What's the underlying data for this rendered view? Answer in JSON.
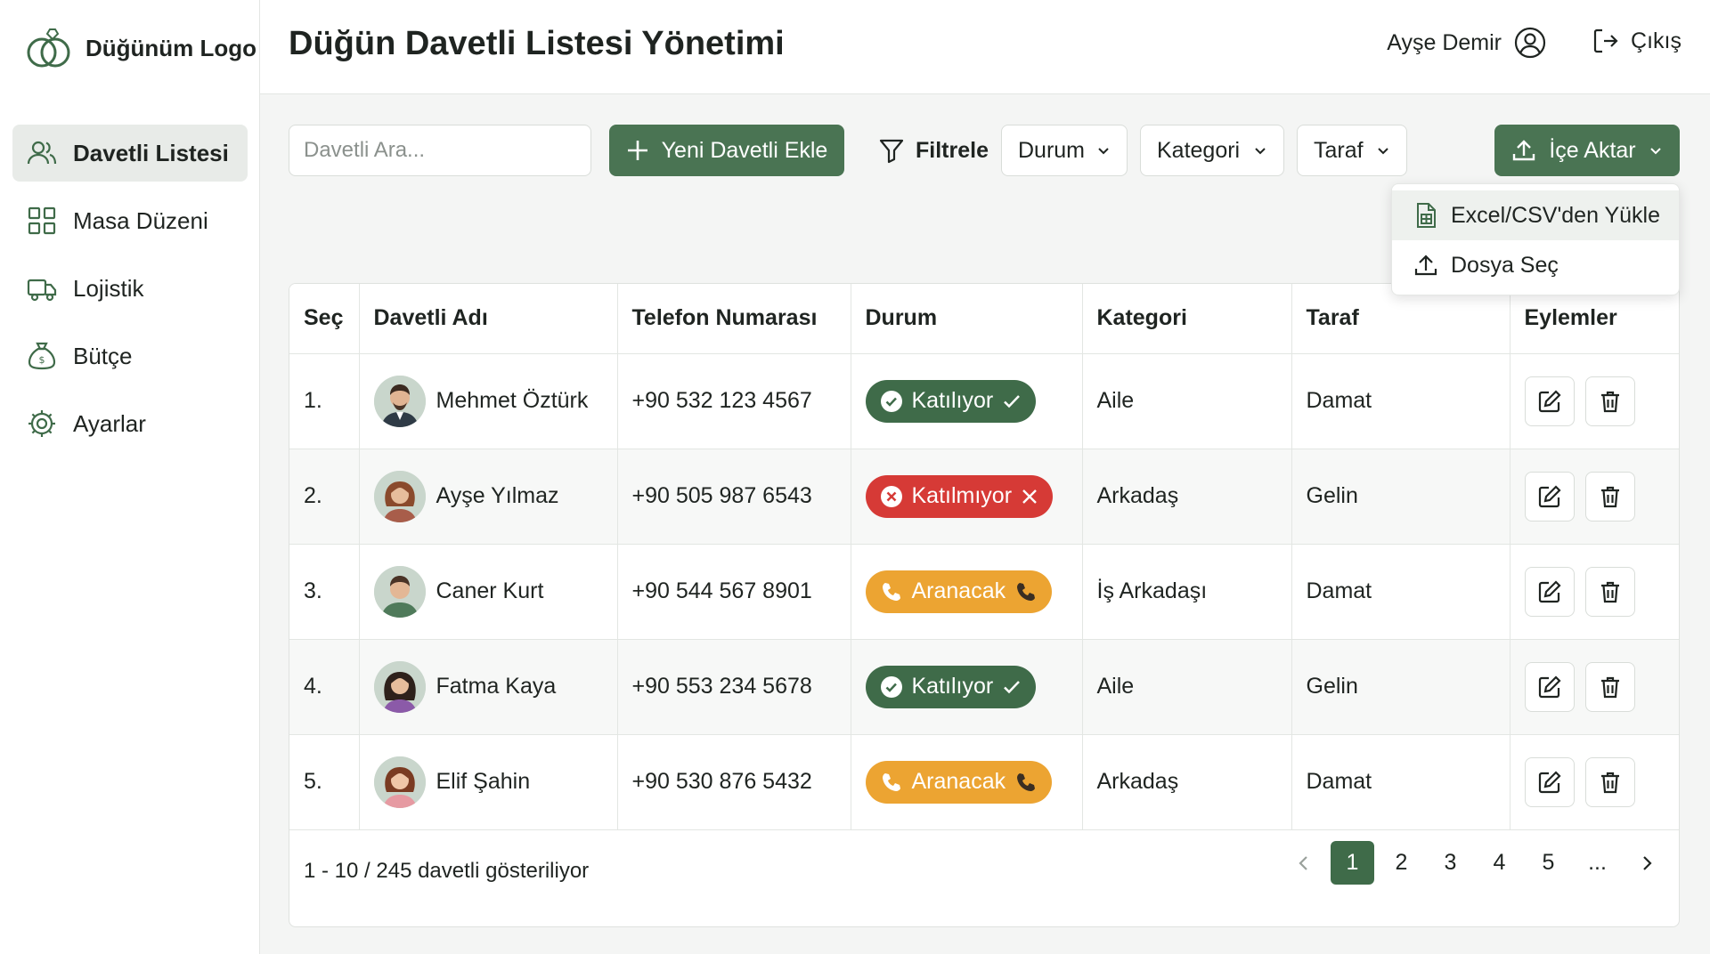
{
  "app": {
    "logo_text": "Düğünüm Logo",
    "page_title": "Düğün Davetli Listesi Yönetimi"
  },
  "sidebar": {
    "items": [
      {
        "label": "Davetli Listesi",
        "icon": "users-icon",
        "active": true
      },
      {
        "label": "Masa Düzeni",
        "icon": "grid-icon",
        "active": false
      },
      {
        "label": "Lojistik",
        "icon": "truck-icon",
        "active": false
      },
      {
        "label": "Bütçe",
        "icon": "money-bag-icon",
        "active": false
      },
      {
        "label": "Ayarlar",
        "icon": "gear-icon",
        "active": false
      }
    ]
  },
  "header": {
    "user_name": "Ayşe Demir",
    "logout_label": "Çıkış"
  },
  "toolbar": {
    "search_placeholder": "Davetli Ara...",
    "add_label": "Yeni Davetli Ekle",
    "filter_label": "Filtrele",
    "status_dd": "Durum",
    "category_dd": "Kategori",
    "side_dd": "Taraf",
    "import_label": "İçe Aktar"
  },
  "import_menu": {
    "items": [
      {
        "label": "Excel/CSV'den Yükle",
        "icon": "spreadsheet-file-icon"
      },
      {
        "label": "Dosya Seç",
        "icon": "upload-icon"
      }
    ]
  },
  "table": {
    "headers": [
      "Seç",
      "Davetli Adı",
      "Telefon Numarası",
      "Durum",
      "Kategori",
      "Taraf",
      "Eylemler"
    ],
    "rows": [
      {
        "no": "1.",
        "name": "Mehmet Öztürk",
        "phone": "+90 532 123 4567",
        "status": "Katılıyor",
        "status_kind": "att",
        "category": "Aile",
        "side": "Damat"
      },
      {
        "no": "2.",
        "name": "Ayşe Yılmaz",
        "phone": "+90 505 987 6543",
        "status": "Katılmıyor",
        "status_kind": "no",
        "category": "Arkadaş",
        "side": "Gelin"
      },
      {
        "no": "3.",
        "name": "Caner Kurt",
        "phone": "+90 544 567 8901",
        "status": "Aranacak",
        "status_kind": "call",
        "category": "İş Arkadaşı",
        "side": "Damat"
      },
      {
        "no": "4.",
        "name": "Fatma Kaya",
        "phone": "+90 553 234 5678",
        "status": "Katılıyor",
        "status_kind": "att",
        "category": "Aile",
        "side": "Gelin"
      },
      {
        "no": "5.",
        "name": "Elif Şahin",
        "phone": "+90 530 876 5432",
        "status": "Aranacak",
        "status_kind": "call",
        "category": "Arkadaş",
        "side": "Damat"
      }
    ]
  },
  "footer": {
    "summary": "1 - 10 / 245 davetli gösteriliyor",
    "pages": [
      "1",
      "2",
      "3",
      "4",
      "5",
      "..."
    ],
    "active_page": "1"
  },
  "colors": {
    "primary": "#4a7453",
    "attending": "#3f6b49",
    "not_attending": "#d63a36",
    "to_call": "#eca432"
  }
}
